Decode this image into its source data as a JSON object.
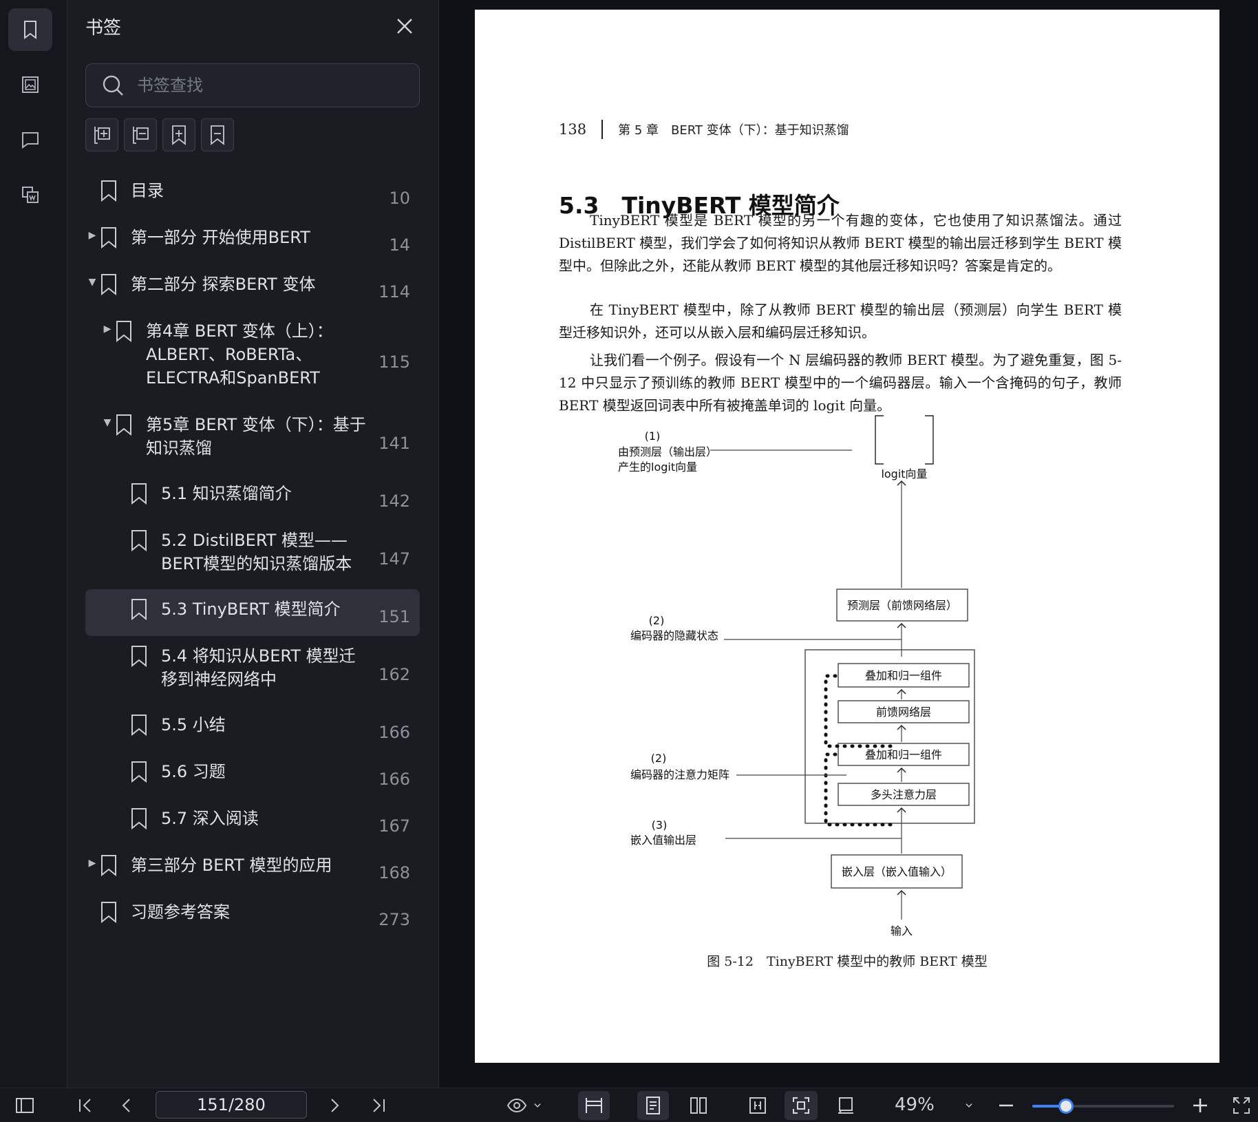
{
  "panel": {
    "title": "书签",
    "search_placeholder": "书签查找"
  },
  "bookmarks": [
    {
      "label": "目录",
      "page": "10",
      "level": 0,
      "arrow": ""
    },
    {
      "label": "第一部分 开始使用BERT",
      "page": "14",
      "level": 0,
      "arrow": "▶"
    },
    {
      "label": "第二部分 探索BERT 变体",
      "page": "114",
      "level": 0,
      "arrow": "▼"
    },
    {
      "label": "第4章 BERT 变体（上）：ALBERT、RoBERTa、ELECTRA和SpanBERT",
      "page": "115",
      "level": 1,
      "arrow": "▶"
    },
    {
      "label": "第5章 BERT 变体（下）：基于知识蒸馏",
      "page": "141",
      "level": 1,
      "arrow": "▼"
    },
    {
      "label": "5.1 知识蒸馏简介",
      "page": "142",
      "level": 2,
      "arrow": ""
    },
    {
      "label": "5.2 DistilBERT 模型——BERT模型的知识蒸馏版本",
      "page": "147",
      "level": 2,
      "arrow": ""
    },
    {
      "label": "5.3 TinyBERT 模型简介",
      "page": "151",
      "level": 2,
      "arrow": "",
      "selected": true
    },
    {
      "label": "5.4 将知识从BERT 模型迁移到神经网络中",
      "page": "162",
      "level": 2,
      "arrow": ""
    },
    {
      "label": "5.5 小结",
      "page": "166",
      "level": 2,
      "arrow": ""
    },
    {
      "label": "5.6 习题",
      "page": "166",
      "level": 2,
      "arrow": ""
    },
    {
      "label": "5.7 深入阅读",
      "page": "167",
      "level": 2,
      "arrow": ""
    },
    {
      "label": "第三部分 BERT 模型的应用",
      "page": "168",
      "level": 0,
      "arrow": "▶"
    },
    {
      "label": "习题参考答案",
      "page": "273",
      "level": 0,
      "arrow": ""
    }
  ],
  "document": {
    "page_number": "138",
    "chapter_head": "第 5 章　BERT 变体（下）：基于知识蒸馏",
    "section_title": "5.3　TinyBERT 模型简介",
    "paragraphs": [
      "TinyBERT 模型是 BERT 模型的另一个有趣的变体，它也使用了知识蒸馏法。通过 DistilBERT 模型，我们学会了如何将知识从教师 BERT 模型的输出层迁移到学生 BERT 模型中。但除此之外，还能从教师 BERT 模型的其他层迁移知识吗？答案是肯定的。",
      "在 TinyBERT 模型中，除了从教师 BERT 模型的输出层（预测层）向学生 BERT 模型迁移知识外，还可以从嵌入层和编码层迁移知识。",
      "让我们看一个例子。假设有一个 N 层编码器的教师 BERT 模型。为了避免重复，图 5-12 中只显示了预训练的教师 BERT 模型中的一个编码器层。输入一个含掩码的句子，教师 BERT 模型返回词表中所有被掩盖单词的 logit 向量。"
    ],
    "figure": {
      "label_1_num": "(1)",
      "label_1_a": "由预测层（输出层）",
      "label_1_b": "产生的logit向量",
      "logit": "logit向量",
      "prediction_layer": "预测层（前馈网络层）",
      "label_2_num": "(2)",
      "label_2": "编码器的隐藏状态",
      "add_norm_1": "叠加和归一组件",
      "ffn": "前馈网络层",
      "add_norm_2": "叠加和归一组件",
      "label_2b_num": "(2)",
      "label_2b": "编码器的注意力矩阵",
      "mha": "多头注意力层",
      "label_3_num": "(3)",
      "label_3": "嵌入值输出层",
      "embedding": "嵌入层（嵌入值输入）",
      "input": "输入"
    },
    "caption": "图 5-12　TinyBERT 模型中的教师 BERT 模型"
  },
  "toolbar": {
    "page_indicator": "151/280",
    "zoom": "49%",
    "zoom_fraction": 0.24
  },
  "colors": {
    "accent": "#3b82f6",
    "panel_bg": "#1a1c22",
    "selected_bg": "#2e3139"
  }
}
